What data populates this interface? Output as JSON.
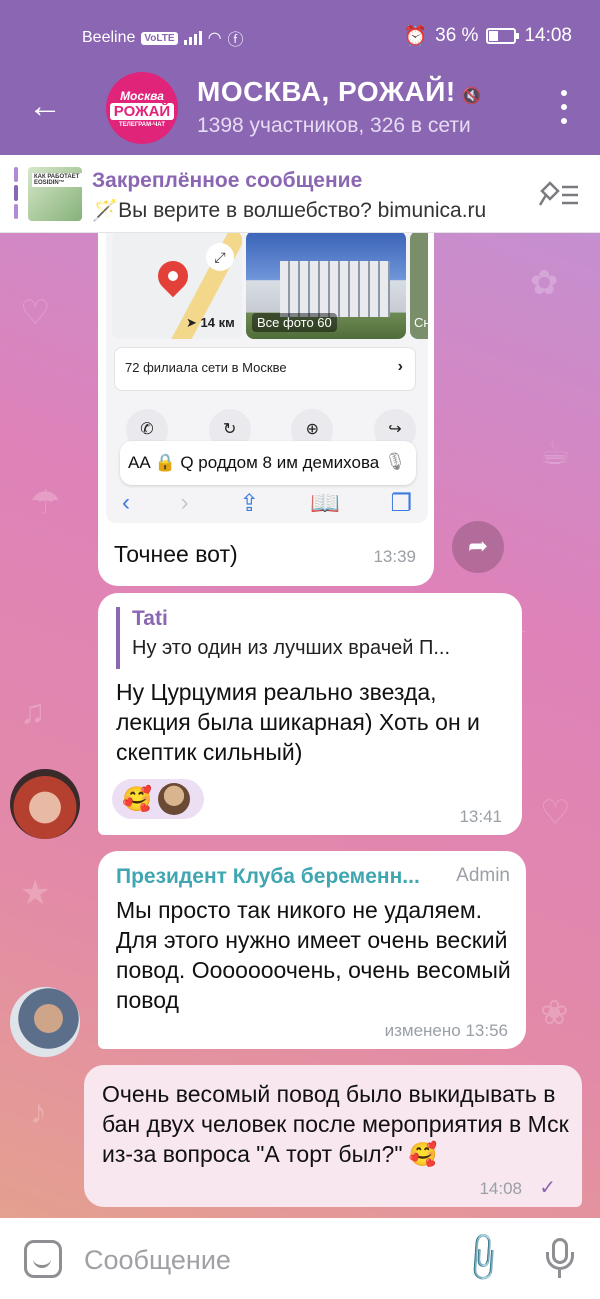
{
  "status_bar": {
    "carrier": "Beeline",
    "volte": "VoLTE",
    "battery_percent": "36 %",
    "time": "14:08"
  },
  "header": {
    "avatar_line1": "Москва",
    "avatar_line2": "РОЖАЙ",
    "avatar_line3": "ТЕЛЕГРАМ-ЧАТ",
    "title": "МОСКВА, РОЖАЙ!",
    "subtitle": "1398 участников, 326 в сети"
  },
  "pinned": {
    "thumb_caption": "КАК РАБОТАЕТ EOSIDIN™",
    "title": "Закреплённое сообщение",
    "text": "🪄Вы верите в волшебство?   bimunica.ru"
  },
  "messages": [
    {
      "type": "screenshot",
      "screenshot": {
        "distance": "14 км",
        "photo_label": "Все фото  60",
        "photo_label2": "Сн",
        "branches": "72 филиала сети в Москве",
        "address": "AA  🔒 Q роддом 8 им демихова"
      },
      "text": "Точнее вот)",
      "time": "13:39"
    },
    {
      "type": "reply",
      "reply_name": "Tati",
      "reply_text": "Ну это один из лучших врачей П...",
      "text": "Ну Цурцумия реально звезда, лекция была шикарная) Хоть он и скептик сильный)",
      "reaction_emoji": "🥰",
      "time": "13:41"
    },
    {
      "type": "admin",
      "sender": "Президент Клуба беременн...",
      "badge": "Admin",
      "text": "Мы просто так никого не удаляем. Для этого нужно имеет очень веский повод. Ооооооочень, очень весомый повод",
      "time": "изменено 13:56"
    },
    {
      "type": "outgoing",
      "text": "Очень весомый повод было выкидывать в бан двух человек после мероприятия в Мск из-за вопроса \"А торт был?\" 🥰",
      "time": "14:08",
      "status": "✓"
    }
  ],
  "input": {
    "placeholder": "Сообщение"
  },
  "colors": {
    "header": "#8a66b3",
    "accent": "#8a66b3",
    "admin_name": "#3fa6b2",
    "outgoing_bubble": "#f8e7ef"
  }
}
